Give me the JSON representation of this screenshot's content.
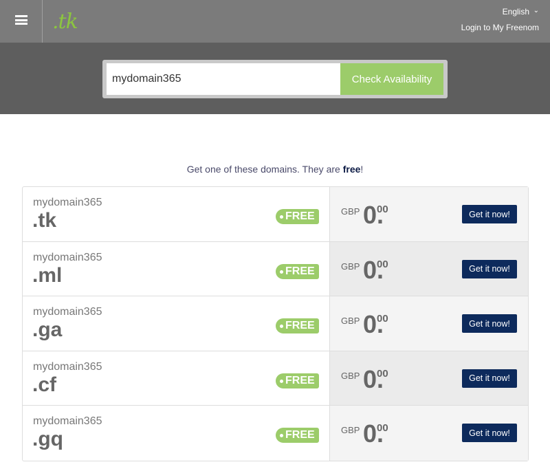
{
  "header": {
    "logo": ".tk",
    "language": "English",
    "login": "Login to My Freenom"
  },
  "search": {
    "value": "mydomain365",
    "button": "Check Availability"
  },
  "tagline": {
    "text": "Get one of these domains. They are ",
    "bold": "free",
    "end": "!"
  },
  "results": [
    {
      "name": "mydomain365",
      "tld": ".tk",
      "badge": "FREE",
      "currency": "GBP",
      "price": "0.",
      "cents": "00",
      "button": "Get it now!"
    },
    {
      "name": "mydomain365",
      "tld": ".ml",
      "badge": "FREE",
      "currency": "GBP",
      "price": "0.",
      "cents": "00",
      "button": "Get it now!"
    },
    {
      "name": "mydomain365",
      "tld": ".ga",
      "badge": "FREE",
      "currency": "GBP",
      "price": "0.",
      "cents": "00",
      "button": "Get it now!"
    },
    {
      "name": "mydomain365",
      "tld": ".cf",
      "badge": "FREE",
      "currency": "GBP",
      "price": "0.",
      "cents": "00",
      "button": "Get it now!"
    },
    {
      "name": "mydomain365",
      "tld": ".gq",
      "badge": "FREE",
      "currency": "GBP",
      "price": "0.",
      "cents": "00",
      "button": "Get it now!"
    }
  ],
  "colors": {
    "accent": "#9ccc6a",
    "button": "#0d2a5c",
    "header": "#7b7b7b"
  }
}
